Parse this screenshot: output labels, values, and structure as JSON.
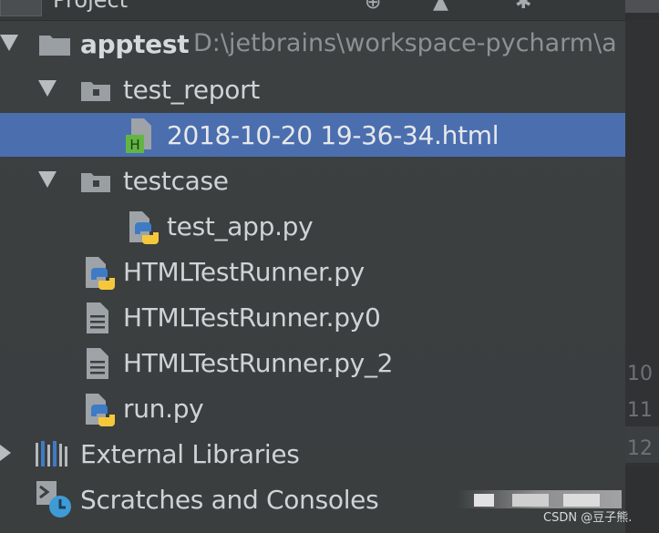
{
  "header": {
    "title": "Project"
  },
  "tree": {
    "root": {
      "name": "apptest",
      "path": "D:\\jetbrains\\workspace-pycharm\\a"
    },
    "test_report": {
      "name": "test_report"
    },
    "report_file": {
      "name": "2018-10-20 19-36-34.html",
      "icon_letter": "H"
    },
    "testcase": {
      "name": "testcase"
    },
    "test_app": {
      "name": "test_app.py"
    },
    "runner": {
      "name": "HTMLTestRunner.py"
    },
    "runner0": {
      "name": "HTMLTestRunner.py0"
    },
    "runner2": {
      "name": "HTMLTestRunner.py_2"
    },
    "run": {
      "name": "run.py"
    },
    "external": {
      "name": "External Libraries"
    },
    "scratches": {
      "name": "Scratches and Consoles"
    }
  },
  "gutter": {
    "line_10": "10",
    "line_11": "11",
    "line_12": "12"
  },
  "watermark": "CSDN @豆子熊.",
  "colors": {
    "selection": "#4b6eaf",
    "python_blue": "#3f7bc4",
    "python_yellow": "#f5c83c",
    "html_green": "#62b543"
  }
}
